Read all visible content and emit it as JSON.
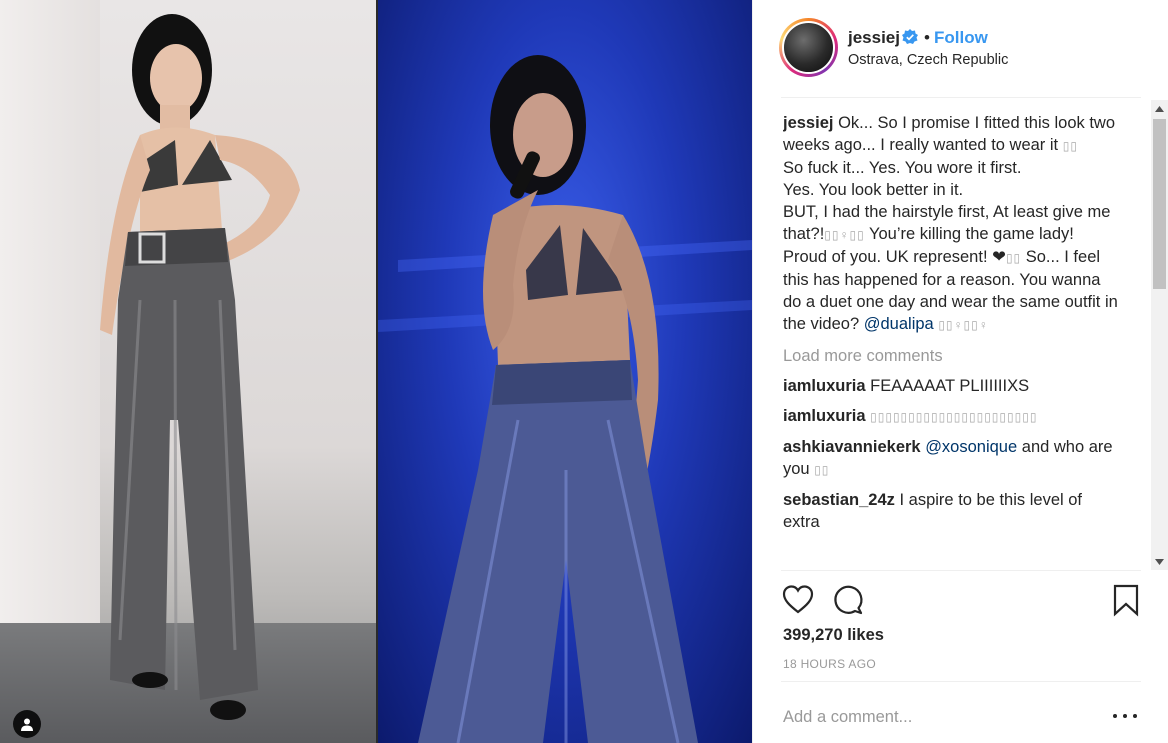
{
  "post": {
    "username": "jessiej",
    "separator": "•",
    "follow_label": "Follow",
    "location": "Ostrava, Czech Republic",
    "caption_lines": [
      "Ok... So I promise I fitted this look two weeks ago... I really wanted to wear it",
      "So fuck it... Yes. You wore it first.",
      "Yes. You look better in it.",
      "BUT, I had the hairstyle first, At least give me that?!",
      "You’re killing the game lady!",
      "Proud of you. UK represent! ❤",
      "So... I feel this has happened for a reason. You wanna do a duet one day and wear the same outfit in the video?",
      "@dualipa"
    ],
    "load_more_label": "Load more comments",
    "comments": [
      {
        "user": "iamluxuria",
        "text": "FEAAAAAT PLIIIIIIXS"
      },
      {
        "user": "iamluxuria",
        "text": ""
      },
      {
        "user": "ashkiavanniekerk",
        "mention": "@xosonique",
        "text": "and who are you"
      },
      {
        "user": "sebastian_24z",
        "text": "I aspire to be this level of extra"
      }
    ],
    "likes": "399,270 likes",
    "timestamp": "18 HOURS AGO",
    "add_comment_placeholder": "Add a comment..."
  },
  "colors": {
    "link": "#3897f0",
    "mention": "#003569",
    "muted": "#999999",
    "text": "#262626"
  },
  "icons": [
    "verified-badge-icon",
    "heart-icon",
    "comment-icon",
    "bookmark-icon",
    "more-options-icon",
    "user-tag-icon"
  ]
}
